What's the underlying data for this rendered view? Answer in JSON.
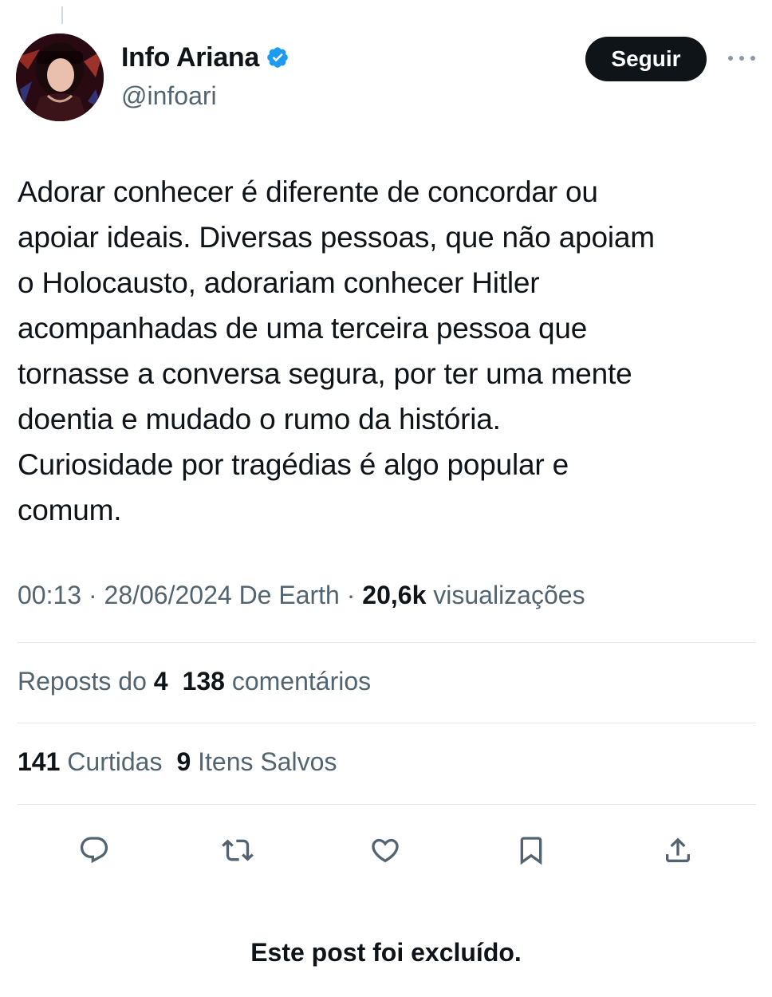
{
  "author": {
    "display_name": "Info Ariana",
    "handle": "@infoari",
    "verified_icon": "verified-badge-icon",
    "badge_color": "#1d9bf0"
  },
  "toolbar": {
    "follow_label": "Seguir",
    "more_icon": "more-horizontal-icon"
  },
  "tweet": {
    "text": "Adorar conhecer é diferente de concordar ou\napoiar ideais. Diversas pessoas, que não apoiam\no Holocausto, adorariam conhecer Hitler\nacompanhadas de uma terceira pessoa que\ntornasse a conversa segura, por ter uma mente\ndoentia e mudado o rumo da história.\nCuriosidade por tragédias é algo popular e\ncomum."
  },
  "meta": {
    "time": "00:13",
    "sep1": " · ",
    "date": "28/06/2024",
    "source": " De Earth",
    "sep2": " · ",
    "views_count": "20,6k",
    "views_label": " visualizações"
  },
  "stats": {
    "reposts_label": "Reposts do ",
    "reposts_count": "4",
    "comments_count": "138",
    "comments_label": " comentários",
    "likes_count": "141",
    "likes_label": " Curtidas",
    "saves_count": "9",
    "saves_label": " Itens Salvos"
  },
  "actions": [
    {
      "icon": "reply-icon"
    },
    {
      "icon": "retweet-icon"
    },
    {
      "icon": "like-heart-icon"
    },
    {
      "icon": "bookmark-icon"
    },
    {
      "icon": "share-icon"
    }
  ],
  "notice": {
    "deleted": "Este post foi excluído."
  },
  "colors": {
    "text": "#0f1419",
    "secondary": "#536471",
    "divider": "#e3e8ec",
    "follow_bg": "#0f1419"
  }
}
